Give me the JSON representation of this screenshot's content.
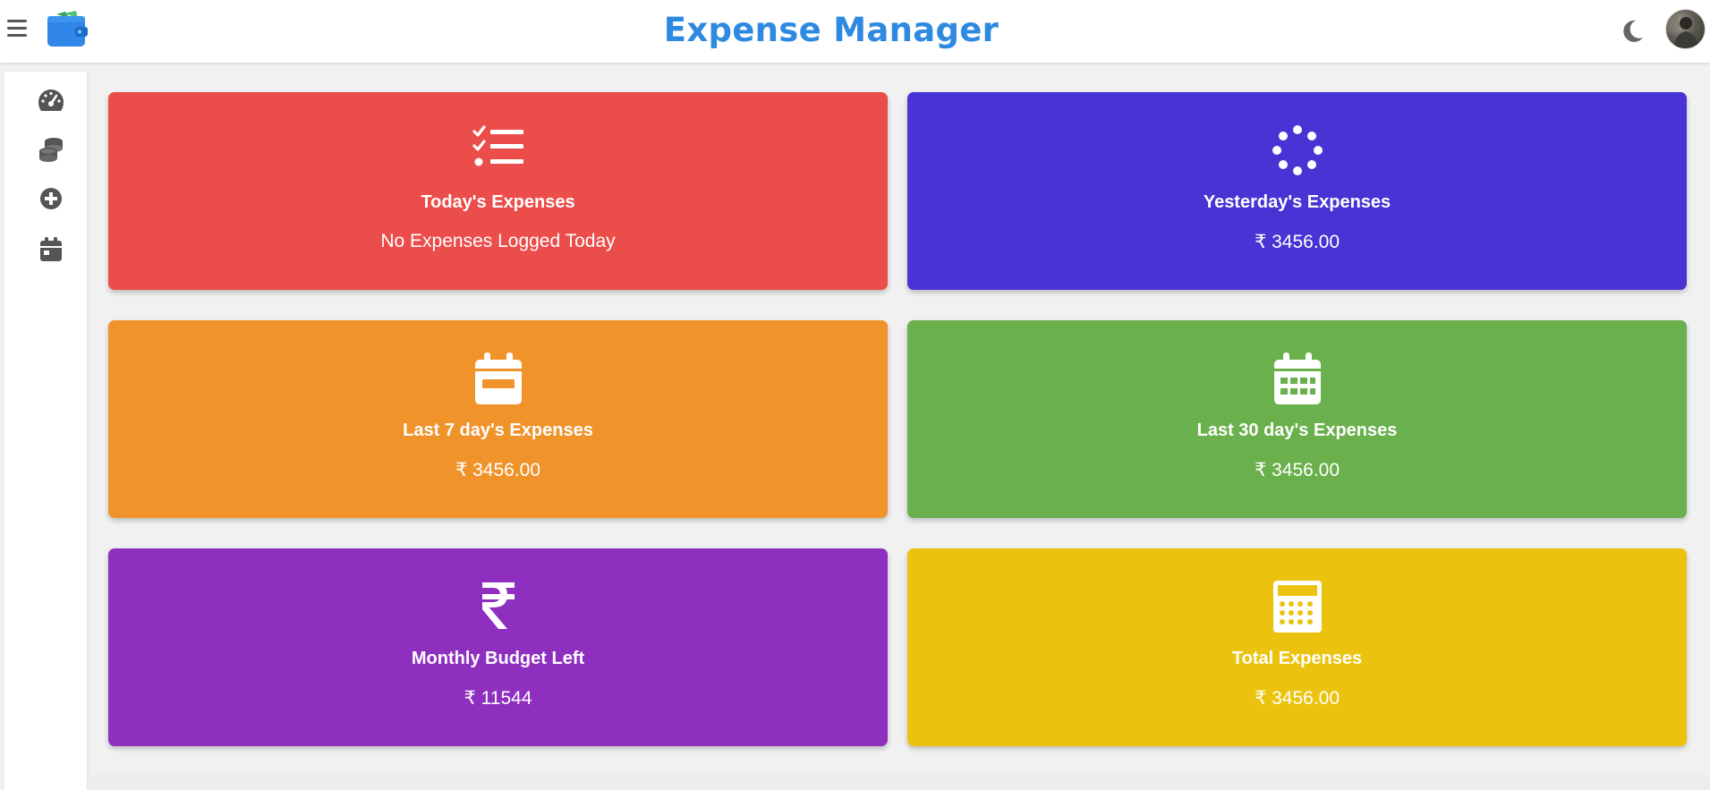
{
  "header": {
    "title": "Expense Manager",
    "menu_icon": "hamburger-icon",
    "logo_icon": "wallet-icon",
    "theme_icon": "moon-icon",
    "avatar": "user-avatar"
  },
  "sidebar": {
    "items": [
      {
        "icon": "dashboard-gauge-icon"
      },
      {
        "icon": "coins-icon"
      },
      {
        "icon": "add-circle-icon"
      },
      {
        "icon": "calendar-icon"
      }
    ]
  },
  "cards": [
    {
      "label": "Today's Expenses",
      "value": "No Expenses Logged Today",
      "color": "#eb4d4b",
      "icon": "checklist-icon"
    },
    {
      "label": "Yesterday's Expenses",
      "value": "₹ 3456.00",
      "color": "#4834d4",
      "icon": "spinner-icon"
    },
    {
      "label": "Last 7 day's Expenses",
      "value": "₹ 3456.00",
      "color": "#f0932b",
      "icon": "calendar-week-icon"
    },
    {
      "label": "Last 30 day's Expenses",
      "value": "₹ 3456.00",
      "color": "#6ab04c",
      "icon": "calendar-month-icon"
    },
    {
      "label": "Monthly Budget Left",
      "value": "₹ 11544",
      "color": "#8e2fbf",
      "icon": "rupee-icon"
    },
    {
      "label": "Total Expenses",
      "value": "₹ 3456.00",
      "color": "#ebc30f",
      "icon": "calculator-icon"
    }
  ],
  "colors": {
    "title": "#2e8ae0",
    "background": "#f1f1f1",
    "icon_gray": "#555555"
  }
}
